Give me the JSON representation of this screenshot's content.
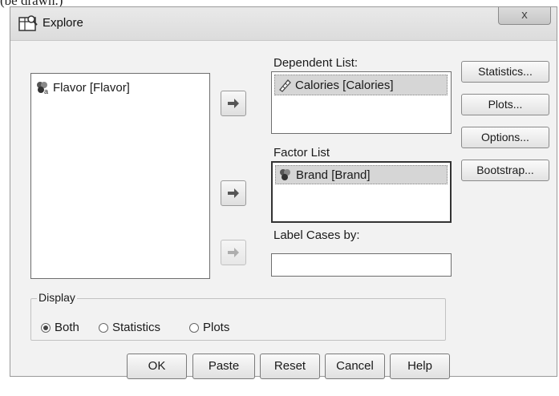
{
  "fragment_above": "(be drawn.)",
  "window": {
    "title": "Explore",
    "close_symbol": "x"
  },
  "source_list": {
    "items": [
      {
        "label": "Flavor [Flavor]",
        "icon": "nominal-variable-icon"
      }
    ]
  },
  "dependent_list": {
    "label": "Dependent List:",
    "items": [
      {
        "label": "Calories [Calories]",
        "icon": "scale-variable-icon",
        "selected": true
      }
    ]
  },
  "factor_list": {
    "label": "Factor List",
    "items": [
      {
        "label": "Brand [Brand]",
        "icon": "nominal-variable-icon",
        "selected": true
      }
    ]
  },
  "label_cases": {
    "label": "Label Cases by:",
    "value": ""
  },
  "side_buttons": [
    "Statistics...",
    "Plots...",
    "Options...",
    "Bootstrap..."
  ],
  "display": {
    "label": "Display",
    "options": [
      {
        "label": "Both",
        "checked": true
      },
      {
        "label": "Statistics",
        "checked": false
      },
      {
        "label": "Plots",
        "checked": false
      }
    ]
  },
  "bottom_buttons": [
    "OK",
    "Paste",
    "Reset",
    "Cancel",
    "Help"
  ],
  "colors": {
    "dialog_bg": "#f2f2f2",
    "selection": "#d6d6d6"
  }
}
